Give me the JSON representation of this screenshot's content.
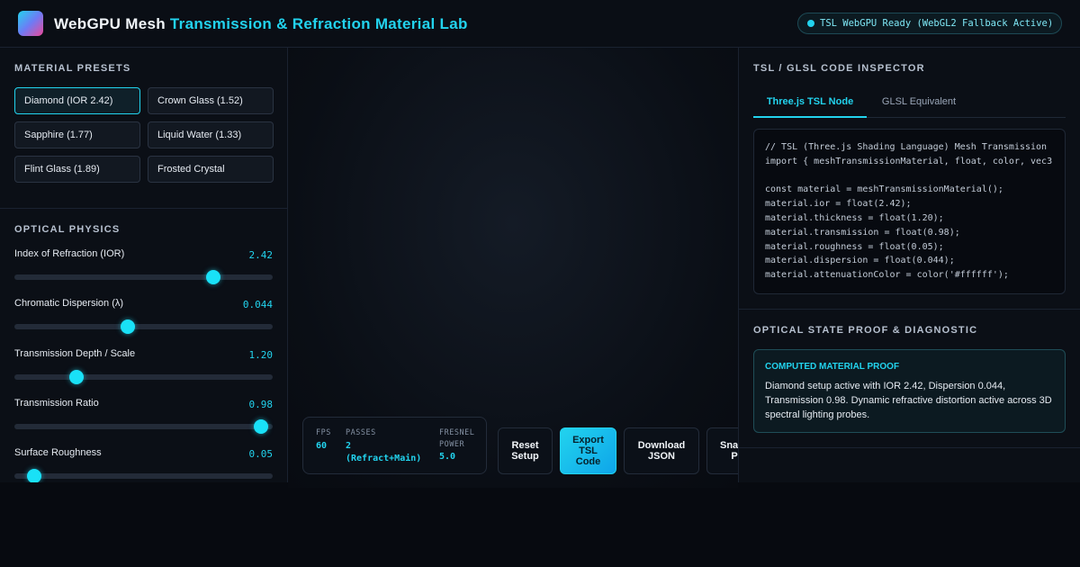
{
  "header": {
    "title_part1": "WebGPU Mesh ",
    "title_part2": "Transmission & Refraction Material Lab",
    "status": "TSL WebGPU Ready (WebGL2 Fallback Active)"
  },
  "presets": {
    "title": "MATERIAL PRESETS",
    "items": [
      {
        "label": "Diamond (IOR 2.42)",
        "active": true
      },
      {
        "label": "Crown Glass (1.52)",
        "active": false
      },
      {
        "label": "Sapphire (1.77)",
        "active": false
      },
      {
        "label": "Liquid Water (1.33)",
        "active": false
      },
      {
        "label": "Flint Glass (1.89)",
        "active": false
      },
      {
        "label": "Frosted Crystal",
        "active": false
      }
    ]
  },
  "physics": {
    "title": "OPTICAL PHYSICS",
    "sliders": [
      {
        "label": "Index of Refraction (IOR)",
        "value": "2.42",
        "fraction": 0.77
      },
      {
        "label": "Chromatic Dispersion (λ)",
        "value": "0.044",
        "fraction": 0.44
      },
      {
        "label": "Transmission Depth / Scale",
        "value": "1.20",
        "fraction": 0.24
      },
      {
        "label": "Transmission Ratio",
        "value": "0.98",
        "fraction": 0.955
      },
      {
        "label": "Surface Roughness",
        "value": "0.05",
        "fraction": 0.075
      }
    ]
  },
  "stats": {
    "fps_label": "FPS",
    "fps_value": "60",
    "passes_label": "PASSES",
    "passes_value": "2",
    "passes_sub": "(Refract+Main)",
    "fresnel_label_1": "FRESNEL",
    "fresnel_label_2": "POWER",
    "fresnel_value": "5.0"
  },
  "actions": {
    "reset": [
      "Reset",
      "Setup"
    ],
    "export": [
      "Export",
      "TSL",
      "Code"
    ],
    "download": [
      "Download",
      "JSON"
    ],
    "snapshot": [
      "Sna",
      "P"
    ]
  },
  "inspector": {
    "title": "TSL / GLSL CODE INSPECTOR",
    "tab_tsl": "Three.js TSL Node",
    "tab_glsl": "GLSL Equivalent",
    "code": "// TSL (Three.js Shading Language) Mesh Transmission\nimport { meshTransmissionMaterial, float, color, vec3\n\nconst material = meshTransmissionMaterial();\nmaterial.ior = float(2.42);\nmaterial.thickness = float(1.20);\nmaterial.transmission = float(0.98);\nmaterial.roughness = float(0.05);\nmaterial.dispersion = float(0.044);\nmaterial.attenuationColor = color('#ffffff');"
  },
  "proof": {
    "title": "OPTICAL STATE PROOF & DIAGNOSTIC",
    "heading": "COMPUTED MATERIAL PROOF",
    "text": "Diamond setup active with IOR 2.42, Dispersion 0.044, Transmission 0.98. Dynamic refractive distortion active across 3D spectral lighting probes."
  },
  "colors": {
    "accent": "#22d3ee",
    "background": "#070a10",
    "panel": "#0b0f16"
  }
}
